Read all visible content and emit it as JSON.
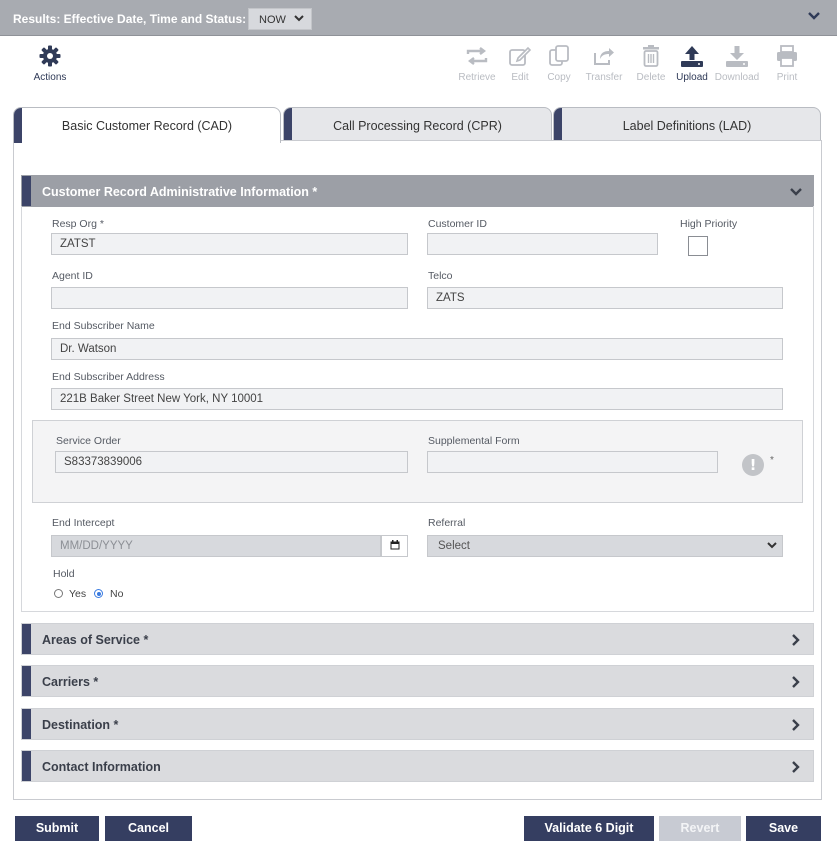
{
  "results_bar": {
    "label": "Results: Effective Date, Time and Status:",
    "selected_value": "NOW"
  },
  "toolbar": {
    "actions_label": "Actions",
    "retrieve": "Retrieve",
    "edit": "Edit",
    "copy": "Copy",
    "transfer": "Transfer",
    "delete": "Delete",
    "upload": "Upload",
    "download": "Download",
    "print": "Print"
  },
  "tabs": [
    {
      "label": "Basic Customer Record (CAD)",
      "active": true
    },
    {
      "label": "Call Processing Record (CPR)",
      "active": false
    },
    {
      "label": "Label Definitions (LAD)",
      "active": false
    }
  ],
  "cra": {
    "title": "Customer Record Administrative Information *",
    "resp_org_label": "Resp Org *",
    "resp_org_value": "ZATST",
    "customer_id_label": "Customer ID",
    "customer_id_value": "",
    "high_priority_label": "High Priority",
    "agent_id_label": "Agent ID",
    "agent_id_value": "",
    "telco_label": "Telco",
    "telco_value": "ZATS",
    "end_subscriber_name_label": "End Subscriber Name",
    "end_subscriber_name_value": "Dr. Watson",
    "end_subscriber_address_label": "End Subscriber Address",
    "end_subscriber_address_value": "221B Baker Street New York, NY 10001",
    "service_order_label": "Service Order",
    "service_order_value": "S83373839006",
    "supplemental_form_label": "Supplemental Form",
    "supplemental_form_value": "",
    "warning_mark": "*",
    "end_intercept_label": "End Intercept",
    "end_intercept_placeholder": "MM/DD/YYYY",
    "referral_label": "Referral",
    "referral_value": "Select",
    "hold_label": "Hold",
    "hold_yes": "Yes",
    "hold_no": "No",
    "hold_selected": "No"
  },
  "sections": {
    "areas_of_service": "Areas of Service *",
    "carriers": "Carriers *",
    "destination": "Destination *",
    "contact_information": "Contact Information"
  },
  "footer": {
    "submit": "Submit",
    "cancel": "Cancel",
    "validate": "Validate 6 Digit",
    "revert": "Revert",
    "save": "Save"
  },
  "colors": {
    "primary": "#353e61",
    "accent_bar": "#3c4468",
    "header_gray": "#a8abb1",
    "disabled": "#c8cbd3"
  }
}
